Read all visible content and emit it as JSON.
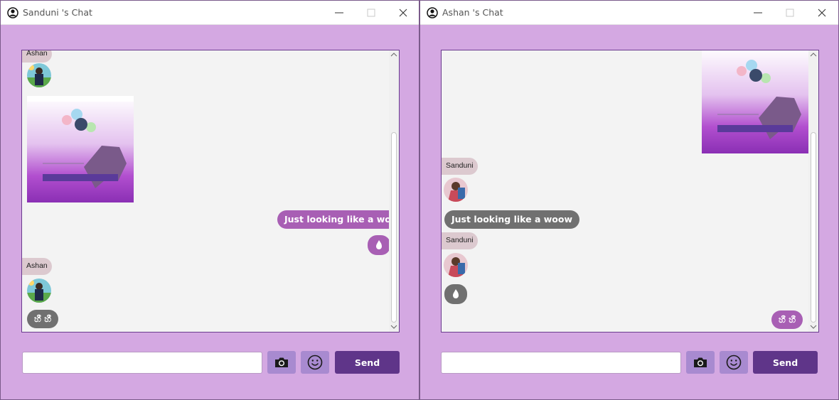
{
  "left_window": {
    "title": "Sanduni 's Chat",
    "messages": {
      "sender_1": "Ashan",
      "outgoing_text": "Just looking like a woow",
      "sender_2": "Ashan",
      "incoming_text": "හී හී"
    },
    "composer": {
      "input_value": "",
      "send_label": "Send"
    }
  },
  "right_window": {
    "title": "Ashan 's Chat",
    "messages": {
      "sender_1": "Sanduni",
      "incoming_text": "Just looking like a woow",
      "sender_2": "Sanduni",
      "outgoing_text": "හී හී"
    },
    "composer": {
      "input_value": "",
      "send_label": "Send"
    }
  },
  "icons": [
    "user-icon",
    "minimize-icon",
    "maximize-icon",
    "close-icon",
    "camera-icon",
    "emoji-icon",
    "fire-icon"
  ],
  "colors": {
    "window_bg": "#d4a8e2",
    "chat_bg": "#f3f3f3",
    "own_bubble": "#a85fb4",
    "other_bubble": "#707070",
    "send_button": "#5f3589",
    "icon_button": "#a88ad0",
    "name_badge": "#dcc9cf"
  }
}
